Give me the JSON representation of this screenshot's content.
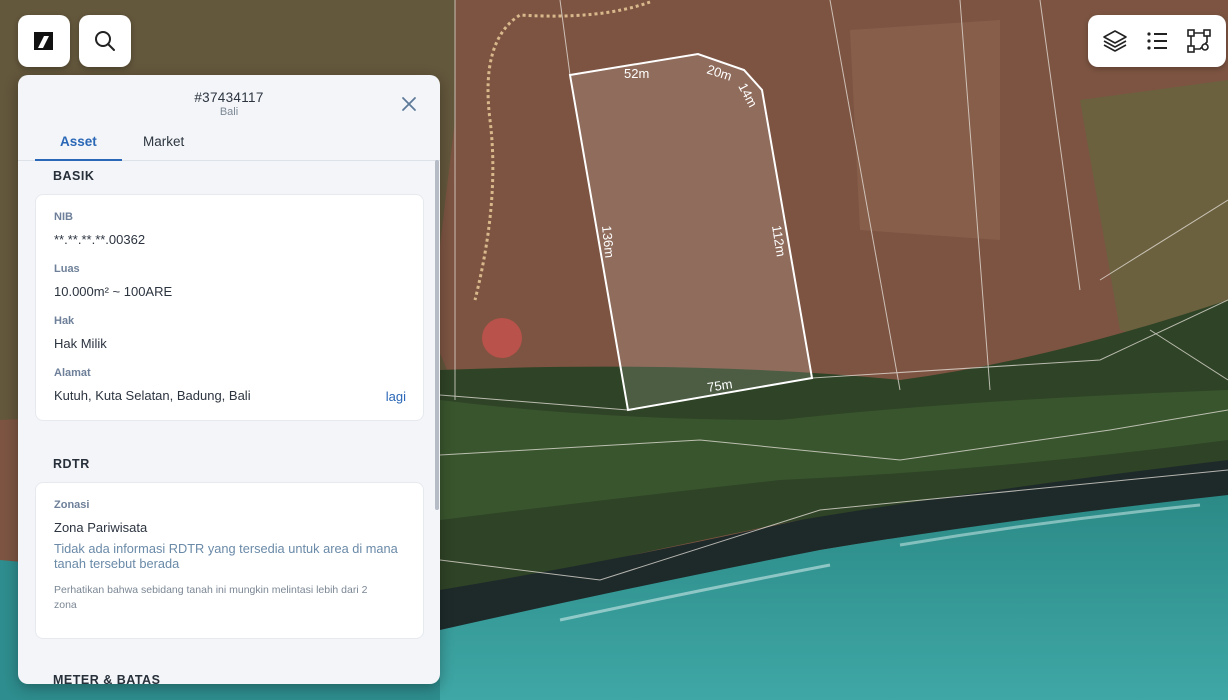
{
  "map": {
    "dimensions": {
      "top": "52m",
      "top_right": "20m",
      "right_short": "14m",
      "left": "136m",
      "right": "112m",
      "bottom": "75m"
    }
  },
  "toolbar": {
    "logo_icon": "brand-logo-icon",
    "search_icon": "search-icon",
    "tools": [
      "layers-icon",
      "list-icon",
      "polygon-draw-icon"
    ]
  },
  "panel": {
    "parcel_id": "#37434117",
    "region": "Bali",
    "tabs": [
      {
        "label": "Asset",
        "active": true
      },
      {
        "label": "Market",
        "active": false
      }
    ],
    "basik": {
      "title": "BASIK",
      "fields": [
        {
          "label": "NIB",
          "value": "**.**.**.**.00362"
        },
        {
          "label": "Luas",
          "value": "10.000m² ~ 100ARE"
        },
        {
          "label": "Hak",
          "value": "Hak Milik"
        },
        {
          "label": "Alamat",
          "value": "Kutuh, Kuta Selatan, Badung, Bali",
          "link": "lagi"
        }
      ]
    },
    "rdtr": {
      "title": "RDTR",
      "zonasi_label": "Zonasi",
      "zonasi_value": "Zona Pariwisata",
      "note": "Tidak ada informasi RDTR yang tersedia untuk area di mana tanah tersebut berada",
      "small": "Perhatikan bahwa sebidang tanah ini mungkin melintasi lebih dari 2 zona"
    },
    "next_section": "METER & BATAS"
  },
  "colors": {
    "accent": "#2a67b7",
    "sea": "#1f7f86",
    "land": "#8a5a45"
  }
}
